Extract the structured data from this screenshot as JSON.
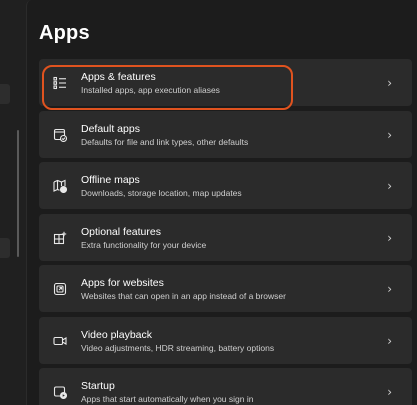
{
  "page": {
    "title": "Apps"
  },
  "items": [
    {
      "title": "Apps & features",
      "desc": "Installed apps, app execution aliases",
      "icon": "apps-list-icon",
      "highlighted": true
    },
    {
      "title": "Default apps",
      "desc": "Defaults for file and link types, other defaults",
      "icon": "default-apps-icon"
    },
    {
      "title": "Offline maps",
      "desc": "Downloads, storage location, map updates",
      "icon": "offline-maps-icon"
    },
    {
      "title": "Optional features",
      "desc": "Extra functionality for your device",
      "icon": "optional-features-icon"
    },
    {
      "title": "Apps for websites",
      "desc": "Websites that can open in an app instead of a browser",
      "icon": "apps-for-websites-icon"
    },
    {
      "title": "Video playback",
      "desc": "Video adjustments, HDR streaming, battery options",
      "icon": "video-playback-icon"
    },
    {
      "title": "Startup",
      "desc": "Apps that start automatically when you sign in",
      "icon": "startup-icon"
    }
  ],
  "chevron": "›",
  "colors": {
    "highlight": "#e0531f",
    "card": "#2b2b2b",
    "background": "#1c1c1c"
  }
}
